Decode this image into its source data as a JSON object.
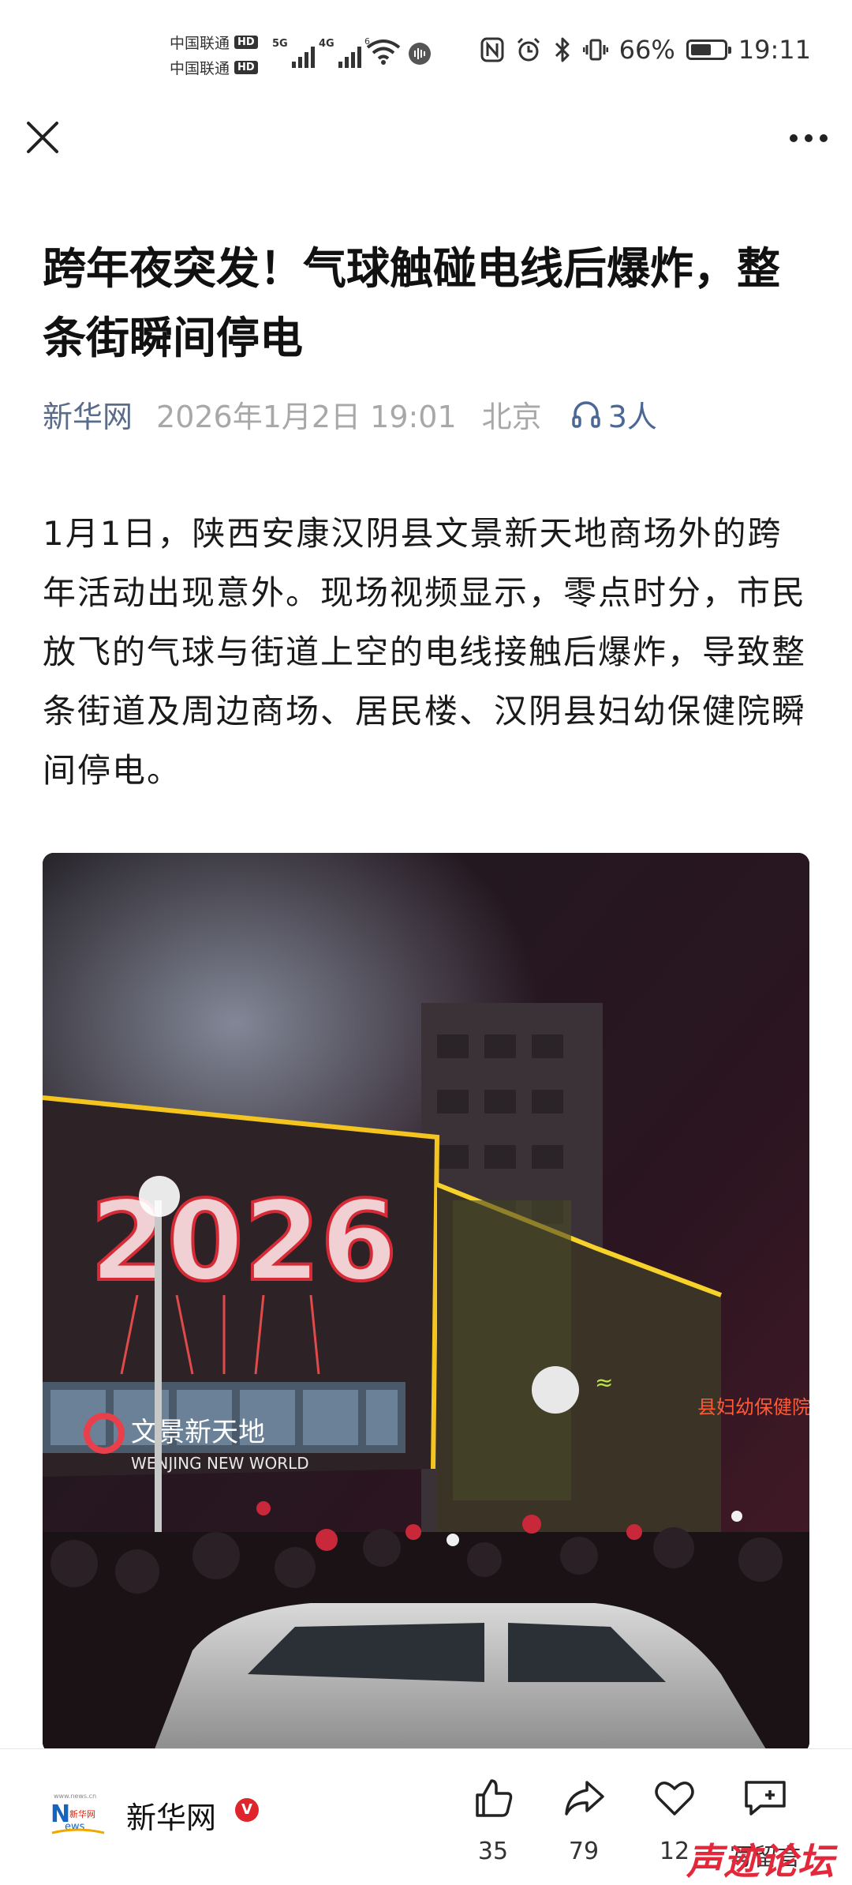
{
  "status_bar": {
    "carrier_1": "中国联通",
    "carrier_2": "中国联通",
    "hd": "HD",
    "net_5g": "5G",
    "net_4g": "4G",
    "wifi_badge": "6",
    "battery_percent": "66%",
    "battery_level": 0.66,
    "time": "19:11",
    "icons": [
      "nfc-icon",
      "alarm-icon",
      "bluetooth-icon",
      "vibrate-icon"
    ]
  },
  "top_bar": {
    "close_icon": "close-icon",
    "more_icon": "more-dots-icon"
  },
  "article": {
    "title": "跨年夜突发！气球触碰电线后爆炸，整条街瞬间停电",
    "source": "新华网",
    "date": "2026年1月2日 19:01",
    "location": "北京",
    "listeners": "3人",
    "body": "1月1日，陕西安康汉阴县文景新天地商场外的跨年活动出现意外。现场视频显示，零点时分，市民放飞的气球与街道上空的电线接触后爆炸，导致整条街道及周边商场、居民楼、汉阴县妇幼保健院瞬间停电。",
    "image": {
      "sign_year": "2026",
      "mall_name": "文景新天地",
      "mall_name_en": "WENJING NEW WORLD",
      "hospital_sign": "县妇幼保健院"
    }
  },
  "bottom_bar": {
    "source": "新华网",
    "verified": "V",
    "logo_text": "新华网",
    "like_count": "35",
    "share_count": "79",
    "favorite_count": "12",
    "comment_label": "写留言",
    "watermark": "声迹论坛"
  },
  "colors": {
    "source_blue": "#5b6c8a",
    "listen_blue": "#4a6796",
    "meta_gray": "#a8a8a8",
    "verified_red": "#e0242b"
  }
}
